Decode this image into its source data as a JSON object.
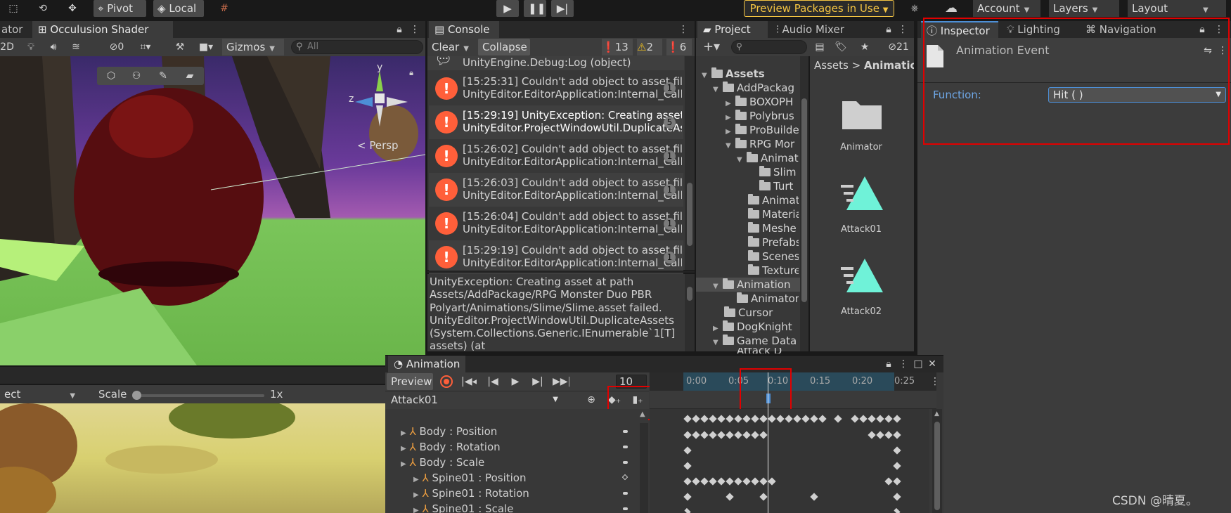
{
  "toolbar": {
    "pivot": "Pivot",
    "local": "Local",
    "preview_packages": "Preview Packages in Use",
    "account": "Account",
    "layers": "Layers",
    "layout": "Layout"
  },
  "scene": {
    "tab_left": "ator",
    "tab_occlusion": "Occulusion Shader",
    "mode_2d": "2D",
    "hidden_count": "0",
    "gizmos": "Gizmos",
    "search_placeholder": "All",
    "persp": "< Persp",
    "axis_y": "y",
    "axis_z": "z"
  },
  "game": {
    "display_dd": "ect",
    "scale_label": "Scale",
    "scale_value": "1x"
  },
  "console": {
    "tab": "Console",
    "clear": "Clear",
    "collapse": "Collapse",
    "errors": "13",
    "warnings": "2",
    "logs": "6",
    "top_partial": "UnityEngine.Debug:Log (object)",
    "rows": [
      {
        "l1": "[15:25:31] Couldn't add object to asset file b",
        "l2": "UnityEditor.EditorApplication:Internal_CallGl",
        "count": "1"
      },
      {
        "l1": "[15:29:19] UnityException: Creating asset at",
        "l2": "UnityEditor.ProjectWindowUtil.DuplicateAss",
        "count": "5"
      },
      {
        "l1": "[15:26:02] Couldn't add object to asset file b",
        "l2": "UnityEditor.EditorApplication:Internal_CallGl",
        "count": "1"
      },
      {
        "l1": "[15:26:03] Couldn't add object to asset file b",
        "l2": "UnityEditor.EditorApplication:Internal_CallGl",
        "count": "1"
      },
      {
        "l1": "[15:26:04] Couldn't add object to asset file b",
        "l2": "UnityEditor.EditorApplication:Internal_CallGl",
        "count": "1"
      },
      {
        "l1": "[15:29:19] Couldn't add object to asset file b",
        "l2": "UnityEditor.EditorApplication:Internal_CallGl",
        "count": "1"
      }
    ],
    "detail": [
      "UnityException: Creating asset at path",
      "Assets/AddPackage/RPG Monster Duo PBR",
      "Polyart/Animations/Slime/Slime.asset failed.",
      "UnityEditor.ProjectWindowUtil.DuplicateAssets",
      "(System.Collections.Generic.IEnumerable`1[T]",
      "assets) (at"
    ]
  },
  "project": {
    "tab": "Project",
    "audio_mixer": "Audio Mixer",
    "hidden_count": "21",
    "tree": [
      "Assets",
      "AddPackag",
      "BOXOPH",
      "Polybrus",
      "ProBuilde",
      "RPG Mor",
      "Animat",
      "Slim",
      "Turt",
      "Animat",
      "Materia",
      "Meshe",
      "Prefabs",
      "Scenes",
      "Texture",
      "Animation",
      "Animator",
      "Cursor",
      "DogKnight",
      "Game Data",
      "Attack D"
    ],
    "breadcrumb_root": "Assets",
    "breadcrumb_sep": ">",
    "breadcrumb_current": "Animation",
    "assets": [
      "Animator",
      "Attack01",
      "Attack02"
    ]
  },
  "inspector": {
    "tab": "Inspector",
    "lighting": "Lighting",
    "navigation": "Navigation",
    "title": "Animation Event",
    "function_label": "Function:",
    "function_value": "Hit ( )"
  },
  "animation": {
    "tab": "Animation",
    "preview": "Preview",
    "frame": "10",
    "clip": "Attack01",
    "ruler": [
      "0:00",
      "0:05",
      "0:10",
      "0:15",
      "0:20",
      "0:25"
    ],
    "properties": [
      {
        "name": "Body : Position"
      },
      {
        "name": "Body : Rotation"
      },
      {
        "name": "Body : Scale"
      },
      {
        "name": "Spine01 : Position"
      },
      {
        "name": "Spine01 : Rotation"
      },
      {
        "name": "Spine01 : Scale"
      }
    ]
  },
  "watermark": "CSDN @晴夏。",
  "colors": {
    "accent": "#4d8fd6",
    "highlight_red": "#e20000",
    "preview_yellow": "#f5c542",
    "error": "#ff5f3a"
  }
}
